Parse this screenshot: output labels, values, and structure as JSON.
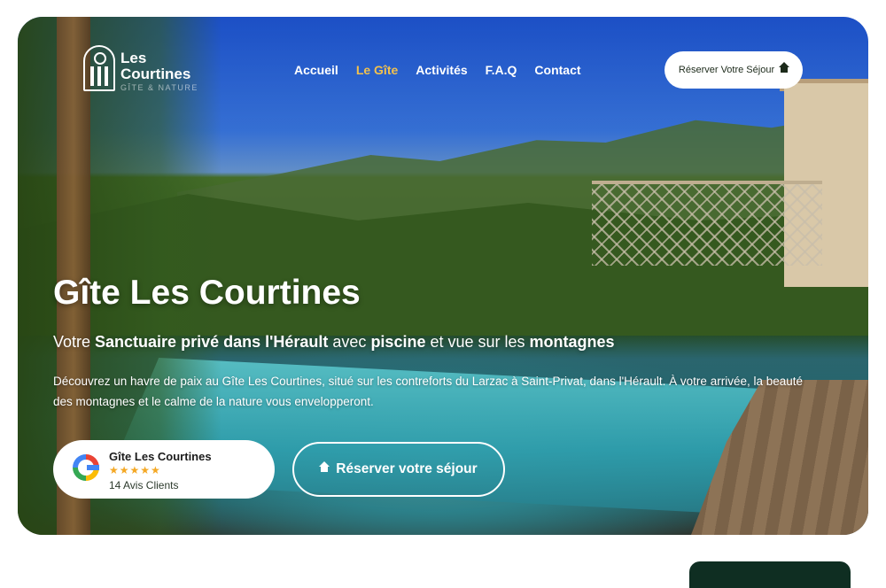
{
  "brand": {
    "line1": "Les",
    "line2": "Courtines",
    "sub": "GÎTE & NATURE"
  },
  "nav": {
    "items": [
      {
        "label": "Accueil",
        "active": false
      },
      {
        "label": "Le Gîte",
        "active": true
      },
      {
        "label": "Activités",
        "active": false
      },
      {
        "label": "F.A.Q",
        "active": false
      },
      {
        "label": "Contact",
        "active": false
      }
    ]
  },
  "header_cta": {
    "label": "Réserver Votre Séjour"
  },
  "hero": {
    "title": "Gîte Les Courtines",
    "subtitle": {
      "p1": "Votre ",
      "b1": "Sanctuaire privé dans l'Hérault",
      "p2": " avec ",
      "b2": "piscine",
      "p3": " et vue sur les ",
      "b3": "montagnes"
    },
    "description": "Découvrez un havre de paix au Gîte Les Courtines, situé sur les contreforts du Larzac à Saint-Privat, dans l'Hérault. À votre arrivée, la beauté des montagnes et le calme de la nature vous envelopperont."
  },
  "review_badge": {
    "name": "Gîte Les Courtines",
    "stars": "★★★★★",
    "rating": 5,
    "count": "14 Avis Clients",
    "icon": "google-icon"
  },
  "cta": {
    "label": "Réserver votre séjour",
    "icon": "home-icon"
  },
  "colors": {
    "accent": "#f2c14e",
    "dark": "#0f2e22",
    "star": "#f4a825"
  }
}
